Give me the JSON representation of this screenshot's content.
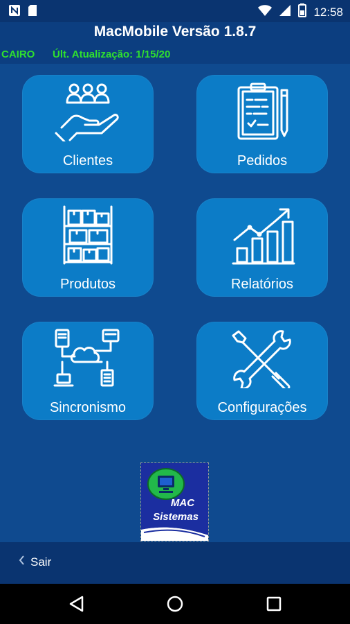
{
  "status_bar": {
    "time": "12:58",
    "icons": [
      "notification-n-icon",
      "sd-card-icon",
      "wifi-icon",
      "signal-icon",
      "battery-icon"
    ]
  },
  "header": {
    "title": "MacMobile Versão 1.8.7",
    "branch": "CAIRO",
    "last_update": "Últ. Atualização: 1/15/20"
  },
  "menu": {
    "clientes": "Clientes",
    "pedidos": "Pedidos",
    "produtos": "Produtos",
    "relatorios": "Relatórios",
    "sincronismo": "Sincronismo",
    "configuracoes": "Configurações"
  },
  "logo": {
    "line1": "MAC",
    "line2": "Sistemas"
  },
  "footer": {
    "back_label": "Sair"
  },
  "colors": {
    "background": "#0f4a8f",
    "tile": "#0c7cc7",
    "header": "#0c3e80",
    "info_text": "#2fe02f"
  }
}
